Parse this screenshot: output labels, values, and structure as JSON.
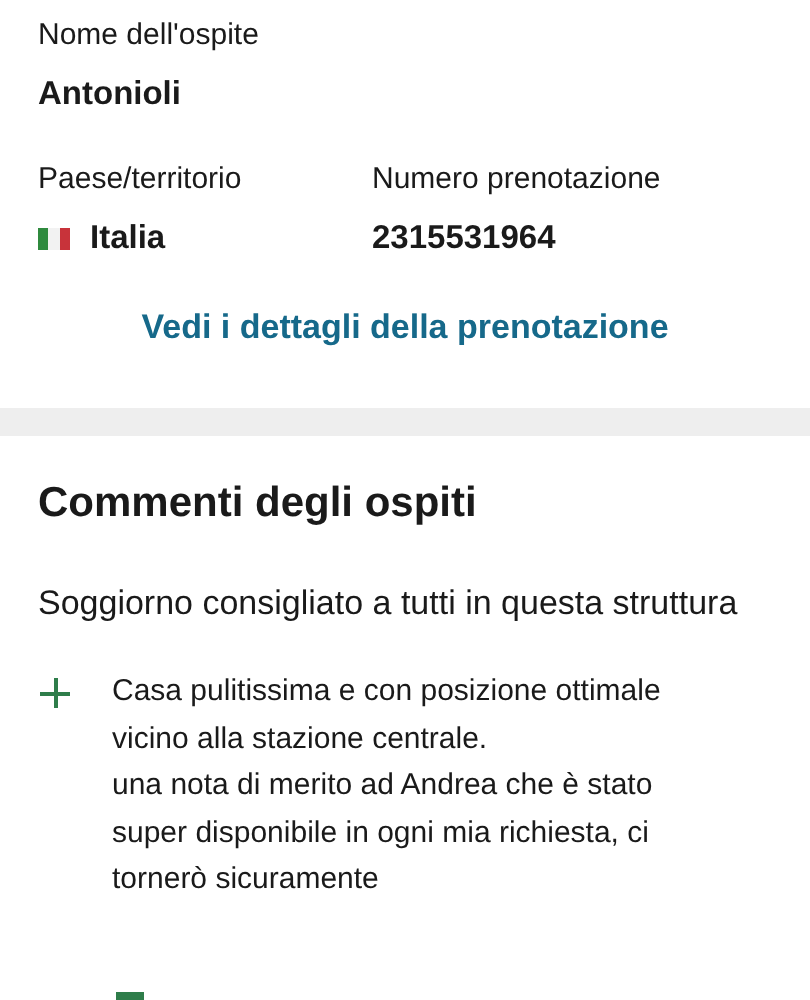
{
  "guest": {
    "label": "Nome dell'ospite",
    "value": "Antonioli"
  },
  "country": {
    "label": "Paese/territorio",
    "value": "Italia"
  },
  "booking": {
    "label": "Numero prenotazione",
    "value": "2315531964"
  },
  "details_link": "Vedi i dettagli della prenotazione",
  "reviews": {
    "title": "Commenti degli ospiti",
    "review_title": "Soggiorno consigliato a tutti in questa struttura",
    "comments": [
      {
        "kind": "positive",
        "text": "Casa pulitissima e con posizione ottimale vicino alla stazione centrale.\nuna nota di merito ad Andrea che è stato super disponibile in ogni mia richiesta, ci tornerò sicuramente"
      }
    ]
  }
}
